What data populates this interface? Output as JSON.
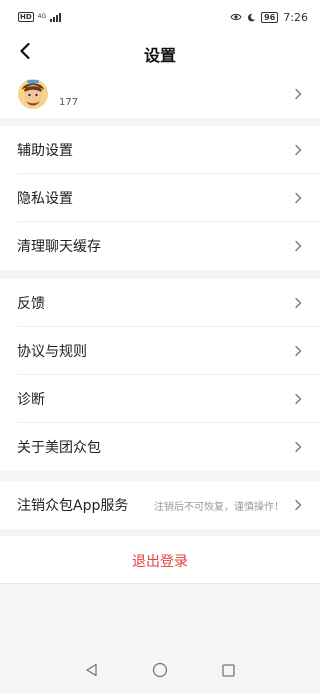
{
  "status_bar": {
    "hd": "HD",
    "network": "4G",
    "battery": "96",
    "time": "7:26"
  },
  "header": {
    "title": "设置"
  },
  "profile": {
    "user_id": "177"
  },
  "group1": {
    "items": [
      {
        "label": "辅助设置"
      },
      {
        "label": "隐私设置"
      },
      {
        "label": "清理聊天缓存"
      }
    ]
  },
  "group2": {
    "items": [
      {
        "label": "反馈"
      },
      {
        "label": "协议与规则"
      },
      {
        "label": "诊断"
      },
      {
        "label": "关于美团众包"
      }
    ]
  },
  "group3": {
    "label": "注销众包App服务",
    "hint": "注销后不可恢复，谨慎操作！"
  },
  "logout": {
    "label": "退出登录"
  },
  "colors": {
    "accent_red": "#e0453a",
    "background": "#f5f5f5",
    "card": "#ffffff"
  },
  "icons": [
    "back-arrow-icon",
    "avatar",
    "chevron-right-icon",
    "eye-icon",
    "moon-icon",
    "battery-icon",
    "nav-back-icon",
    "nav-home-icon",
    "nav-recent-icon"
  ]
}
